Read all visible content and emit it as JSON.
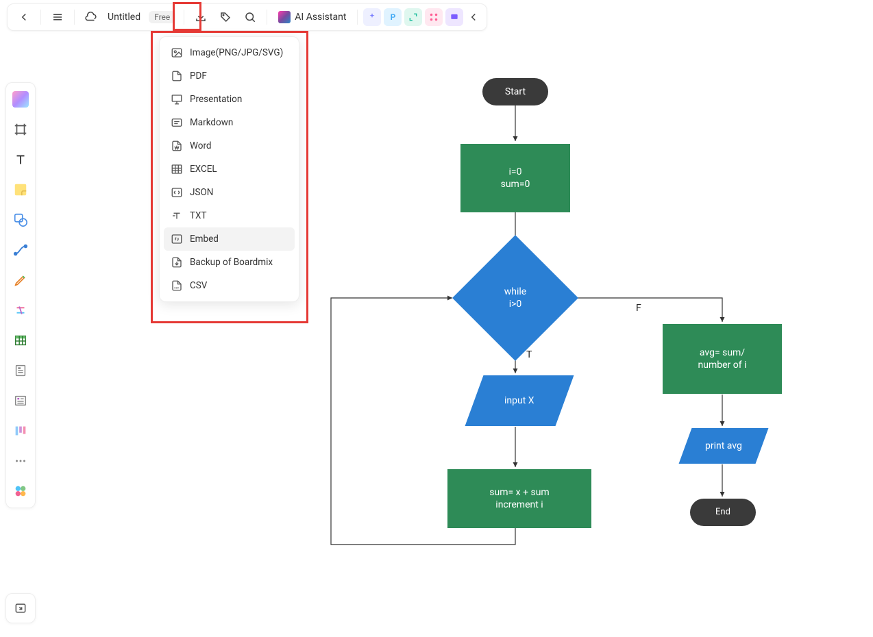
{
  "topbar": {
    "title": "Untitled",
    "badge": "Free",
    "ai_label": "AI Assistant"
  },
  "export_menu": {
    "items": [
      {
        "label": "Image(PNG/JPG/SVG)",
        "icon": "image"
      },
      {
        "label": "PDF",
        "icon": "pdf"
      },
      {
        "label": "Presentation",
        "icon": "presentation"
      },
      {
        "label": "Markdown",
        "icon": "markdown"
      },
      {
        "label": "Word",
        "icon": "word"
      },
      {
        "label": "EXCEL",
        "icon": "excel"
      },
      {
        "label": "JSON",
        "icon": "json"
      },
      {
        "label": "TXT",
        "icon": "txt"
      },
      {
        "label": "Embed",
        "icon": "embed",
        "hovered": true
      },
      {
        "label": "Backup of Boardmix",
        "icon": "backup"
      },
      {
        "label": "CSV",
        "icon": "csv"
      }
    ]
  },
  "flow": {
    "start": "Start",
    "init": "i=0\nsum=0",
    "cond": "while\ni>0",
    "true_label": "T",
    "false_label": "F",
    "input": "input X",
    "sum_step": "sum= x + sum\nincrement i",
    "avg": "avg= sum/\nnumber of i",
    "print": "print avg",
    "end": "End"
  }
}
